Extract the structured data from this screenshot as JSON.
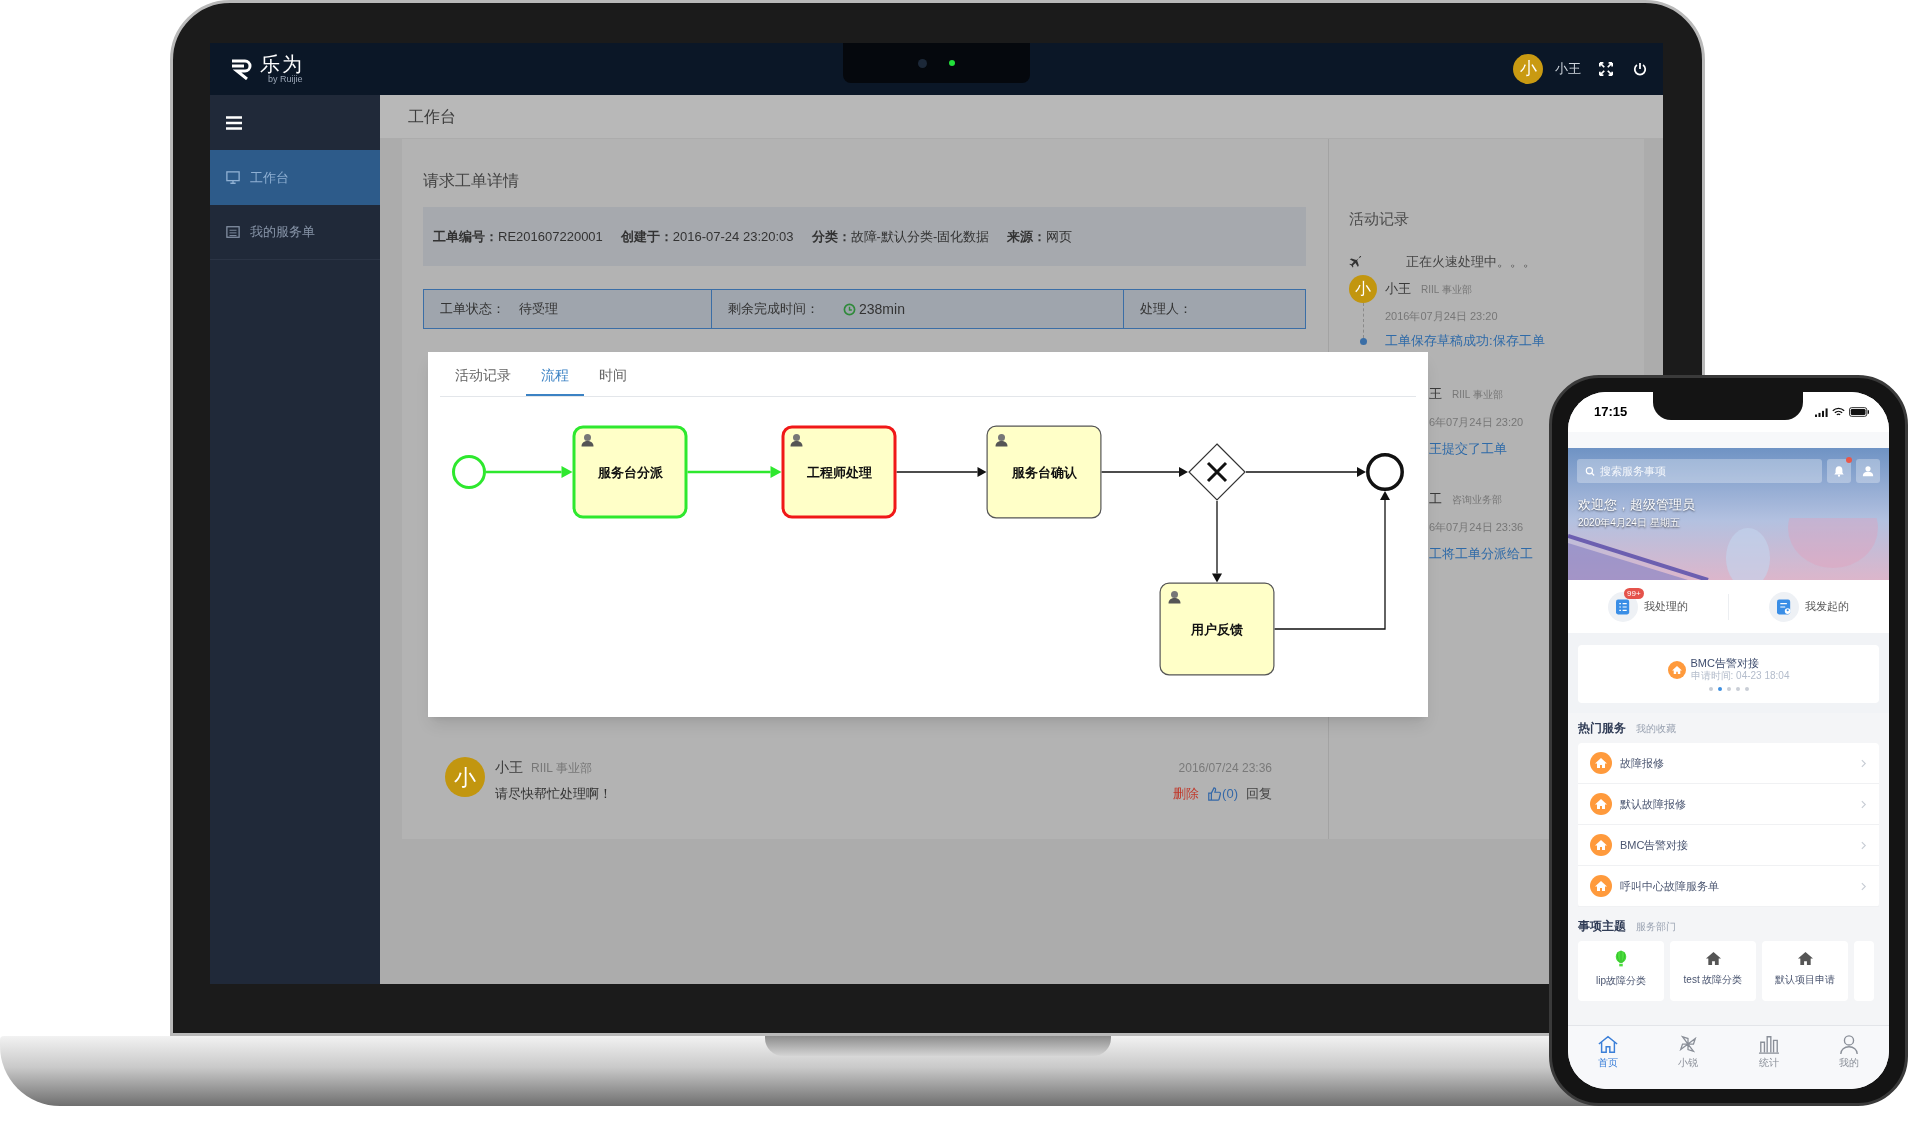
{
  "laptop_app": {
    "logo": {
      "name": "乐为",
      "tagline": "by Ruijie"
    },
    "user": {
      "avatar": "小",
      "name": "小王"
    },
    "sidebar": {
      "items": [
        {
          "label": "工作台",
          "selected": true
        },
        {
          "label": "我的服务单",
          "selected": false
        }
      ]
    },
    "page_title": "工作台",
    "ticket": {
      "title": "请求工单详情",
      "fields": [
        {
          "label": "工单编号：",
          "value": "RE201607220001"
        },
        {
          "label": "创建于：",
          "value": "2016-07-24 23:20:03"
        },
        {
          "label": "分类：",
          "value": "故障-默认分类-固化数据"
        },
        {
          "label": "来源：",
          "value": "网页"
        }
      ],
      "status": [
        {
          "kind": "text",
          "label": "工单状态：",
          "value": "待受理"
        },
        {
          "kind": "timer",
          "label": "剩余完成时间：",
          "value": "238min"
        },
        {
          "kind": "text",
          "label": "处理人："
        }
      ]
    },
    "flow_dialog": {
      "tabs": [
        {
          "label": "活动记录",
          "selected": false
        },
        {
          "label": "流程",
          "selected": true
        },
        {
          "label": "时间",
          "selected": false
        }
      ],
      "nodes": [
        {
          "kind": "start",
          "done": true,
          "active": false
        },
        {
          "kind": "task",
          "label": "服务台分派",
          "done": true,
          "active": false
        },
        {
          "kind": "task",
          "label": "工程师处理",
          "done": false,
          "active": true
        },
        {
          "kind": "task",
          "label": "服务台确认",
          "done": false,
          "active": false
        },
        {
          "kind": "gateway",
          "done": false,
          "active": false
        },
        {
          "kind": "end",
          "done": false,
          "active": false
        },
        {
          "kind": "task",
          "label": "用户反馈",
          "done": false,
          "active": false
        }
      ],
      "edges": [
        {
          "done": true
        },
        {
          "done": true
        },
        {
          "done": false
        },
        {
          "done": false
        },
        {
          "done": false
        },
        {
          "done": false
        },
        {
          "done": false
        }
      ]
    },
    "comment": {
      "avatar": "小",
      "author": "小王",
      "dept": "RIIL 事业部",
      "time": "2016/07/24 23:36",
      "text": "请尽快帮忙处理啊！",
      "delete": "删除",
      "likes": "(0)",
      "reply": "回复"
    },
    "activity": {
      "title": "活动记录",
      "status_text": "正在火速处理中。。。",
      "entries": [
        {
          "avatar": "小",
          "author": "小王",
          "dept": "RIIL 事业部",
          "date": "2016年07月24日 23:20",
          "event": "工单保存草稿成功:保存工单"
        },
        {
          "author": "王",
          "dept": "RIIL 事业部",
          "date": "6年07月24日 23:20",
          "event": "王提交了工单"
        },
        {
          "author": "工",
          "dept": "咨询业务部",
          "date": "6年07月24日 23:36",
          "event": "工将工单分派给工"
        }
      ]
    }
  },
  "phone_app": {
    "time": "17:15",
    "banner": {
      "search_placeholder": "搜索服务事项",
      "notification": true,
      "greeting": "欢迎您，超级管理员",
      "date": "2020年4月24日 星期五"
    },
    "shortcuts": [
      {
        "label": "我处理的",
        "badge": "99+"
      },
      {
        "label": "我发起的"
      }
    ],
    "recent": {
      "title": "BMC告警对接",
      "subtitle": "申请时间: 04-23 18:04",
      "dots": [
        {
          "selected": false
        },
        {
          "selected": true
        },
        {
          "selected": false
        },
        {
          "selected": false
        },
        {
          "selected": false
        }
      ]
    },
    "service_tabs": [
      {
        "label": "热门服务",
        "selected": true
      },
      {
        "label": "我的收藏",
        "selected": false
      }
    ],
    "services": [
      "故障报修",
      "默认故障报修",
      "BMC告警对接",
      "呼叫中心故障服务单"
    ],
    "topic_tabs": [
      {
        "label": "事项主题",
        "selected": true
      },
      {
        "label": "服务部门",
        "selected": false
      }
    ],
    "topics": [
      {
        "kind": "balloon",
        "label": "lip故障分类"
      },
      {
        "kind": "house",
        "label": "test 故障分类"
      },
      {
        "kind": "house",
        "label": "默认项目申请"
      }
    ],
    "nav": [
      {
        "label": "首页",
        "selected": true
      },
      {
        "label": "小锐",
        "selected": false
      },
      {
        "label": "统计",
        "selected": false
      },
      {
        "label": "我的",
        "selected": false
      }
    ]
  }
}
